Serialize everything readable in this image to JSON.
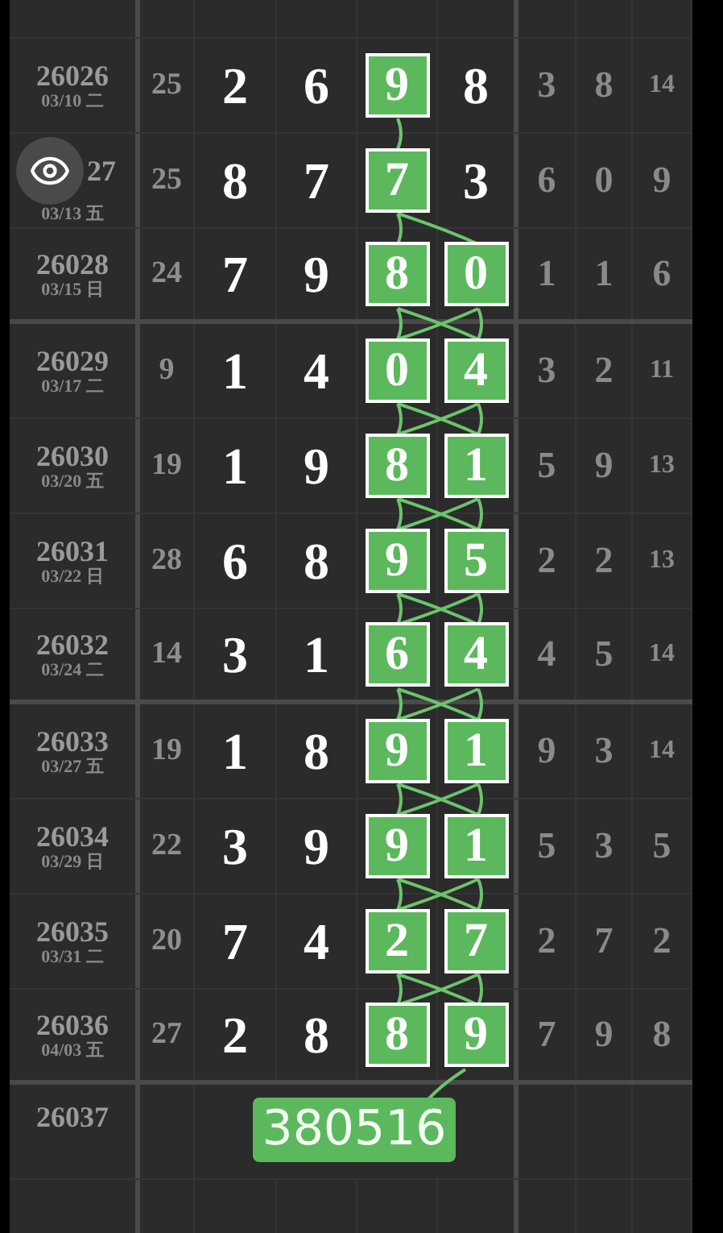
{
  "rows": [
    {
      "id": "26026",
      "date": "03/10 二",
      "sum": "25",
      "digits": [
        {
          "value": "2",
          "highlighted": false
        },
        {
          "value": "6",
          "highlighted": false
        },
        {
          "value": "9",
          "highlighted": true
        },
        {
          "value": "8",
          "highlighted": false
        }
      ],
      "stats": [
        "3",
        "8",
        "14"
      ],
      "group_end": false,
      "eye_button": false
    },
    {
      "id": "27",
      "date": "03/13 五",
      "sum": "25",
      "digits": [
        {
          "value": "8",
          "highlighted": false
        },
        {
          "value": "7",
          "highlighted": false
        },
        {
          "value": "7",
          "highlighted": true
        },
        {
          "value": "3",
          "highlighted": false
        }
      ],
      "stats": [
        "6",
        "0",
        "9"
      ],
      "group_end": false,
      "eye_button": true
    },
    {
      "id": "26028",
      "date": "03/15 日",
      "sum": "24",
      "digits": [
        {
          "value": "7",
          "highlighted": false
        },
        {
          "value": "9",
          "highlighted": false
        },
        {
          "value": "8",
          "highlighted": true
        },
        {
          "value": "0",
          "highlighted": true
        }
      ],
      "stats": [
        "1",
        "1",
        "6"
      ],
      "group_end": true,
      "eye_button": false
    },
    {
      "id": "26029",
      "date": "03/17 二",
      "sum": "9",
      "digits": [
        {
          "value": "1",
          "highlighted": false
        },
        {
          "value": "4",
          "highlighted": false
        },
        {
          "value": "0",
          "highlighted": true
        },
        {
          "value": "4",
          "highlighted": true
        }
      ],
      "stats": [
        "3",
        "2",
        "11"
      ],
      "group_end": false,
      "eye_button": false
    },
    {
      "id": "26030",
      "date": "03/20 五",
      "sum": "19",
      "digits": [
        {
          "value": "1",
          "highlighted": false
        },
        {
          "value": "9",
          "highlighted": false
        },
        {
          "value": "8",
          "highlighted": true
        },
        {
          "value": "1",
          "highlighted": true
        }
      ],
      "stats": [
        "5",
        "9",
        "13"
      ],
      "group_end": false,
      "eye_button": false
    },
    {
      "id": "26031",
      "date": "03/22 日",
      "sum": "28",
      "digits": [
        {
          "value": "6",
          "highlighted": false
        },
        {
          "value": "8",
          "highlighted": false
        },
        {
          "value": "9",
          "highlighted": true
        },
        {
          "value": "5",
          "highlighted": true
        }
      ],
      "stats": [
        "2",
        "2",
        "13"
      ],
      "group_end": false,
      "eye_button": false
    },
    {
      "id": "26032",
      "date": "03/24 二",
      "sum": "14",
      "digits": [
        {
          "value": "3",
          "highlighted": false
        },
        {
          "value": "1",
          "highlighted": false
        },
        {
          "value": "6",
          "highlighted": true
        },
        {
          "value": "4",
          "highlighted": true
        }
      ],
      "stats": [
        "4",
        "5",
        "14"
      ],
      "group_end": true,
      "eye_button": false
    },
    {
      "id": "26033",
      "date": "03/27 五",
      "sum": "19",
      "digits": [
        {
          "value": "1",
          "highlighted": false
        },
        {
          "value": "8",
          "highlighted": false
        },
        {
          "value": "9",
          "highlighted": true
        },
        {
          "value": "1",
          "highlighted": true
        }
      ],
      "stats": [
        "9",
        "3",
        "14"
      ],
      "group_end": false,
      "eye_button": false
    },
    {
      "id": "26034",
      "date": "03/29 日",
      "sum": "22",
      "digits": [
        {
          "value": "3",
          "highlighted": false
        },
        {
          "value": "9",
          "highlighted": false
        },
        {
          "value": "9",
          "highlighted": true
        },
        {
          "value": "1",
          "highlighted": true
        }
      ],
      "stats": [
        "5",
        "3",
        "5"
      ],
      "group_end": false,
      "eye_button": false
    },
    {
      "id": "26035",
      "date": "03/31 二",
      "sum": "20",
      "digits": [
        {
          "value": "7",
          "highlighted": false
        },
        {
          "value": "4",
          "highlighted": false
        },
        {
          "value": "2",
          "highlighted": true
        },
        {
          "value": "7",
          "highlighted": true
        }
      ],
      "stats": [
        "2",
        "7",
        "2"
      ],
      "group_end": false,
      "eye_button": false
    },
    {
      "id": "26036",
      "date": "04/03 五",
      "sum": "27",
      "digits": [
        {
          "value": "2",
          "highlighted": false
        },
        {
          "value": "8",
          "highlighted": false
        },
        {
          "value": "8",
          "highlighted": true
        },
        {
          "value": "9",
          "highlighted": true
        }
      ],
      "stats": [
        "7",
        "9",
        "8"
      ],
      "group_end": true,
      "eye_button": false
    }
  ],
  "next_row": {
    "id": "26037",
    "prediction": "380516"
  }
}
